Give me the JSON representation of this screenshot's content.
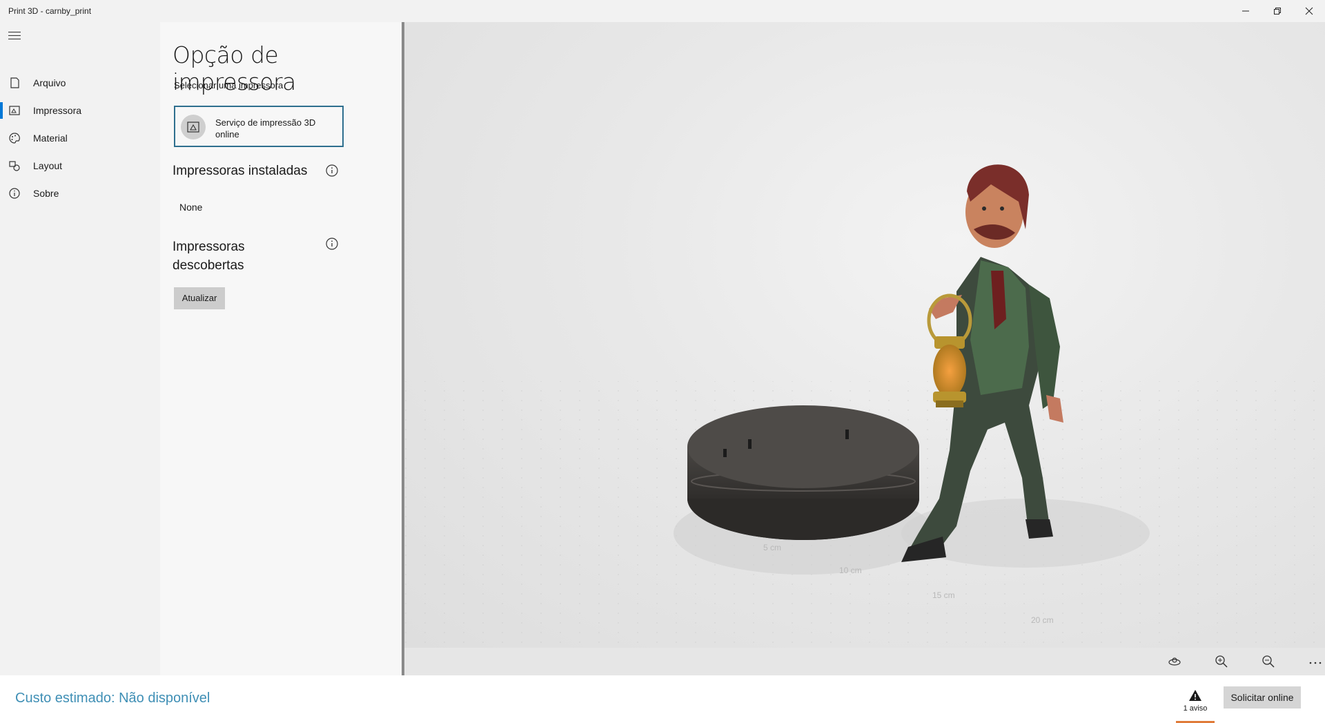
{
  "window": {
    "title": "Print 3D - carnby_print",
    "controls": [
      "minimize-icon",
      "restore-icon",
      "close-icon"
    ]
  },
  "nav": {
    "menu_icon": "hamburger-icon",
    "items": [
      {
        "label": "Arquivo",
        "icon": "file-icon",
        "active": false
      },
      {
        "label": "Impressora",
        "icon": "printer-icon",
        "active": true
      },
      {
        "label": "Material",
        "icon": "palette-icon",
        "active": false
      },
      {
        "label": "Layout",
        "icon": "layout-icon",
        "active": false
      },
      {
        "label": "Sobre",
        "icon": "info-icon",
        "active": false
      }
    ]
  },
  "panel": {
    "title": "Opção de impressora",
    "subtitle": "Selecionar uma impressora",
    "selected_printer": {
      "label": "Serviço de impressão 3D online",
      "icon": "online-print-service-icon"
    },
    "installed": {
      "heading": "Impressoras instaladas",
      "value": "None"
    },
    "discovered": {
      "heading": "Impressoras descobertas",
      "refresh_label": "Atualizar"
    }
  },
  "viewport": {
    "model": "3D model figure with lantern on grid",
    "ruler": [
      "5 cm",
      "10 cm",
      "15 cm",
      "20 cm"
    ],
    "toolbar": [
      "reset-view-icon",
      "zoom-in-icon",
      "zoom-out-icon",
      "more-options-icon"
    ]
  },
  "footer": {
    "cost": "Custo estimado: Não disponível",
    "warning_label": "1 aviso",
    "warning_color": "#e07b39",
    "order_label": "Solicitar online"
  },
  "colors": {
    "accent": "#0078d7",
    "cost_text": "#3f8fb5",
    "card_border": "#2e6f8e"
  }
}
